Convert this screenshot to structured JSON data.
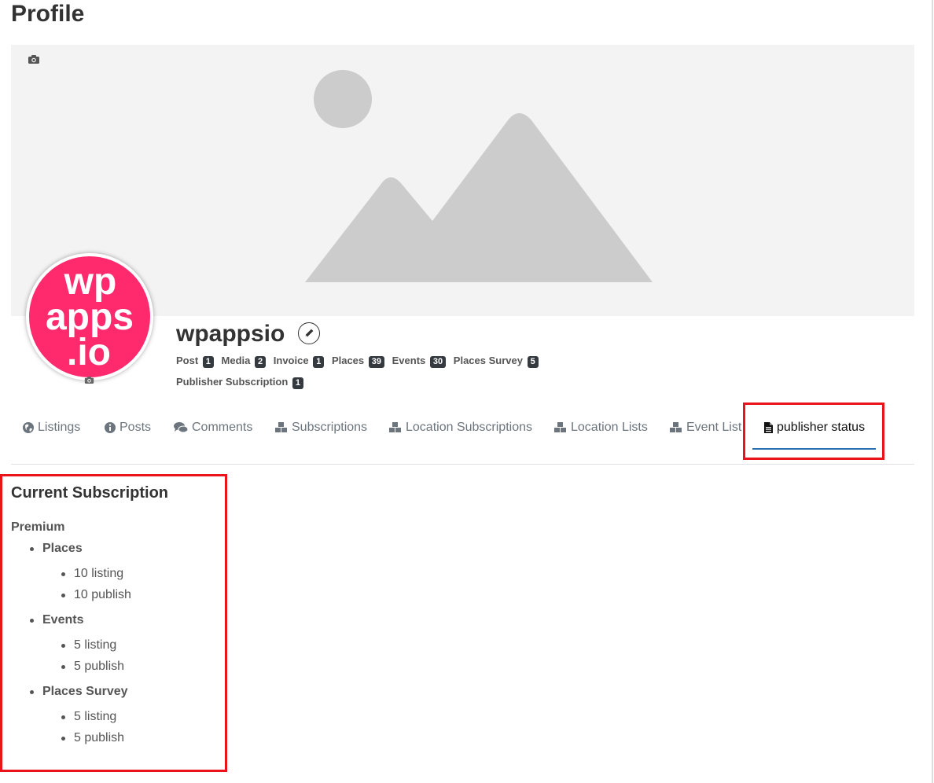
{
  "page": {
    "title": "Profile"
  },
  "profile": {
    "username": "wpappsio",
    "avatar_text": [
      "wp",
      "apps",
      ".io"
    ],
    "stats_row1": [
      {
        "label": "Post",
        "count": "1"
      },
      {
        "label": "Media",
        "count": "2"
      },
      {
        "label": "Invoice",
        "count": "1"
      },
      {
        "label": "Places",
        "count": "39"
      },
      {
        "label": "Events",
        "count": "30"
      },
      {
        "label": "Places Survey",
        "count": "5"
      }
    ],
    "stats_row2": [
      {
        "label": "Publisher Subscription",
        "count": "1"
      }
    ]
  },
  "tabs": [
    {
      "label": "Listings",
      "icon": "globe-icon"
    },
    {
      "label": "Posts",
      "icon": "info-icon"
    },
    {
      "label": "Comments",
      "icon": "comments-icon"
    },
    {
      "label": "Subscriptions",
      "icon": "cubes-icon"
    },
    {
      "label": "Location Subscriptions",
      "icon": "cubes-icon"
    },
    {
      "label": "Location Lists",
      "icon": "cubes-icon"
    },
    {
      "label": "Event List",
      "icon": "cubes-icon"
    },
    {
      "label": "publisher status",
      "icon": "document-icon",
      "active": true
    }
  ],
  "subscription": {
    "heading": "Current Subscription",
    "plan": "Premium",
    "features": [
      {
        "name": "Places",
        "items": [
          "10 listing",
          "10 publish"
        ]
      },
      {
        "name": "Events",
        "items": [
          "5 listing",
          "5 publish"
        ]
      },
      {
        "name": "Places Survey",
        "items": [
          "5 listing",
          "5 publish"
        ]
      }
    ]
  },
  "colors": {
    "avatar": "#ff2a6d",
    "highlight": "#e8141a",
    "tab_underline": "#2a6fb0",
    "badge": "#343a40"
  }
}
